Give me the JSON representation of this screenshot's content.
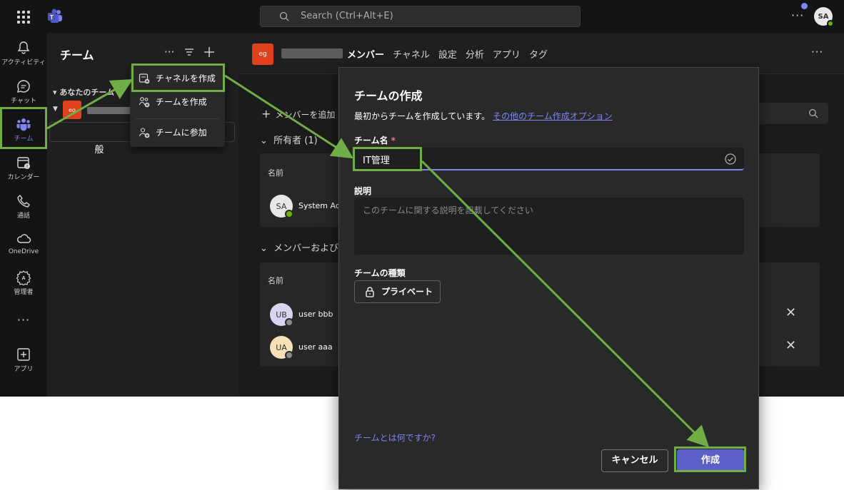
{
  "colors": {
    "accent": "#7f85f5",
    "primary_button": "#5b5fc7",
    "annotation": "#70ad47",
    "team_tile": "#e0401b",
    "presence_available": "#6bb700"
  },
  "topbar": {
    "search_placeholder": "Search (Ctrl+Alt+E)",
    "avatar_initials": "SA"
  },
  "rail": {
    "items": [
      {
        "label": "アクティビティ",
        "icon": "bell-icon"
      },
      {
        "label": "チャット",
        "icon": "chat-icon"
      },
      {
        "label": "チーム",
        "icon": "teams-icon"
      },
      {
        "label": "カレンダー",
        "icon": "calendar-icon"
      },
      {
        "label": "通話",
        "icon": "phone-icon"
      },
      {
        "label": "OneDrive",
        "icon": "cloud-icon"
      },
      {
        "label": "管理者",
        "icon": "admin-icon"
      },
      {
        "label": "アプリ",
        "icon": "apps-icon"
      }
    ],
    "more": "···"
  },
  "teams_pane": {
    "title": "チーム",
    "your_teams": "あなたのチーム",
    "team_tile": "eg",
    "general_channel": "一般"
  },
  "menu": {
    "items": [
      {
        "label": "チャネルを作成",
        "icon": "add-channel-icon"
      },
      {
        "label": "チームを作成",
        "icon": "create-team-icon"
      },
      {
        "label": "チームに参加",
        "icon": "join-team-icon"
      }
    ]
  },
  "main": {
    "team_tile": "eg",
    "tabs": [
      "メンバー",
      "チャネル",
      "設定",
      "分析",
      "アプリ",
      "タグ"
    ],
    "add_member": "メンバーを追加",
    "owners_heading": "所有者 (1)",
    "members_heading": "メンバーおよびゲ",
    "col_name": "名前",
    "owners": [
      {
        "initials": "SA",
        "name": "System Adr",
        "avatar_color": "#e8e8e8"
      }
    ],
    "members": [
      {
        "initials": "UB",
        "name": "user bbb",
        "avatar_color": "#d9d4f0"
      },
      {
        "initials": "UA",
        "name": "user aaa",
        "avatar_color": "#f6e1b8"
      }
    ]
  },
  "dialog": {
    "title": "チームの作成",
    "subtitle": "最初からチームを作成しています。",
    "other_options_link": "その他のチーム作成オプション",
    "name_label": "チーム名",
    "required_mark": "*",
    "name_value": "IT管理",
    "desc_label": "説明",
    "desc_placeholder": "このチームに関する説明を記載してください",
    "type_label": "チームの種類",
    "privacy_value": "プライベート",
    "what_is_team_link": "チームとは何ですか?",
    "cancel_label": "キャンセル",
    "create_label": "作成"
  }
}
